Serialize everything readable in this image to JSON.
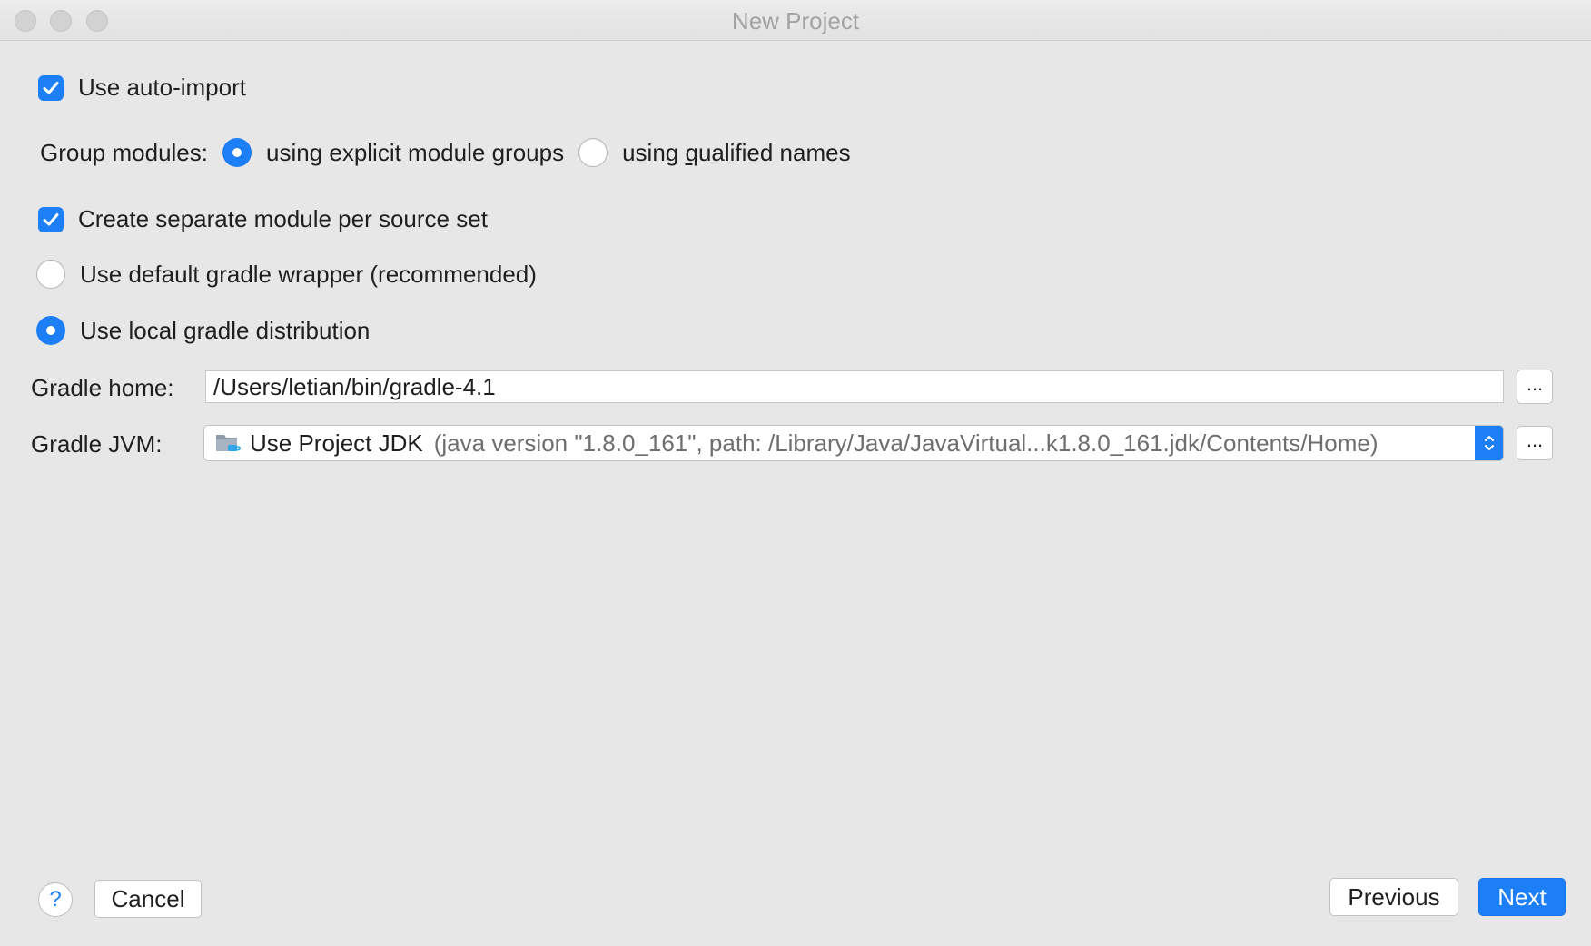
{
  "window": {
    "title": "New Project"
  },
  "options": {
    "auto_import": {
      "label": "Use auto-import",
      "checked": true
    },
    "group_modules": {
      "label": "Group modules:",
      "explicit": {
        "pre": "using explicit module ",
        "u": "g",
        "post": "roups",
        "selected": true
      },
      "qualified": {
        "pre": "using ",
        "u": "q",
        "post": "ualified names",
        "selected": false
      }
    },
    "separate_module": {
      "label": "Create separate module per source set",
      "checked": true
    },
    "default_wrapper": {
      "label": "Use default gradle wrapper (recommended)",
      "selected": false
    },
    "local_distribution": {
      "label": "Use local gradle distribution",
      "selected": true
    }
  },
  "gradle_home": {
    "label": "Gradle home:",
    "value": "/Users/letian/bin/gradle-4.1",
    "browse": "..."
  },
  "gradle_jvm": {
    "label": "Gradle JVM:",
    "selected": "Use Project JDK",
    "detail": "(java version \"1.8.0_161\", path: /Library/Java/JavaVirtual...k1.8.0_161.jdk/Contents/Home)",
    "icon": "jdk-folder-icon",
    "browse": "..."
  },
  "footer": {
    "help": "?",
    "cancel": "Cancel",
    "previous": "Previous",
    "next": "Next"
  },
  "colors": {
    "accent": "#1c7ff5",
    "background": "#e7e7e7"
  }
}
